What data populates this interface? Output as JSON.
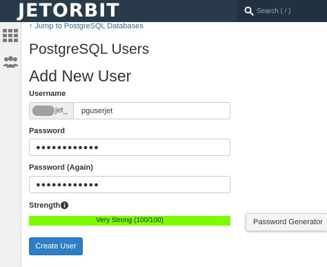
{
  "header": {
    "logo_text": "JETORBIT",
    "search": {
      "placeholder": "Search ( / )",
      "icon": "search-icon"
    }
  },
  "sidebar": {
    "items": [
      {
        "icon": "apps-grid-icon"
      },
      {
        "icon": "users-icon"
      }
    ]
  },
  "main": {
    "jump_link": "↑ Jump to PostgreSQL Databases",
    "page_title": "PostgreSQL Users",
    "section_title": "Add New User",
    "username": {
      "label": "Username",
      "prefix": "jet_",
      "value": "pguserjet"
    },
    "password": {
      "label": "Password",
      "value": "●●●●●●●●●●●●"
    },
    "password_again": {
      "label": "Password (Again)",
      "value": "●●●●●●●●●●●●"
    },
    "strength": {
      "label": "Strength",
      "text": "Very Strong (100/100)",
      "percent": 100,
      "fill_color": "#7dfc00",
      "info_icon": "info-icon"
    },
    "password_generator_label": "Password Generator",
    "create_user_label": "Create User"
  },
  "colors": {
    "topbar": "#293a4a",
    "link": "#2a6db1",
    "primary_button": "#2e7ec5"
  }
}
